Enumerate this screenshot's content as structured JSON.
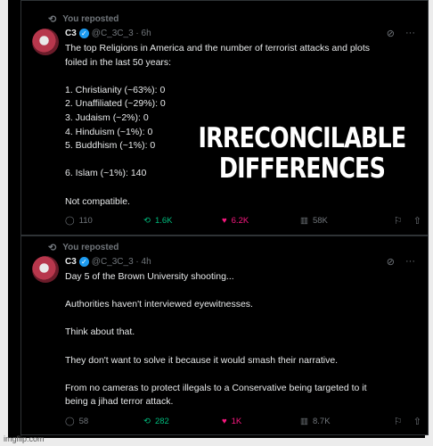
{
  "post1": {
    "repost_label": "You reposted",
    "author_name": "C3",
    "author_handle_time": "@C_3C_3 · 6h",
    "lines": [
      "The top Religions in America and the number of terrorist attacks and plots",
      "foiled in the last 50 years:",
      "",
      "1. Christianity (~63%): 0",
      "2. Unaffiliated (~29%): 0",
      "3. Judaism (~2%): 0",
      "4. Hinduism (~1%): 0",
      "5. Buddhism (~1%): 0",
      "",
      "6. Islam (~1%): 140",
      "",
      "Not compatible."
    ],
    "replies": "110",
    "reposts": "1.6K",
    "likes": "6.2K",
    "views": "58K"
  },
  "post2": {
    "repost_label": "You reposted",
    "author_name": "C3",
    "author_handle_time": "@C_3C_3 · 4h",
    "lines": [
      "Day 5 of the Brown University shooting...",
      "",
      "Authorities haven't interviewed eyewitnesses.",
      "",
      "Think about that.",
      "",
      "They don't want to solve it because it would smash their narrative.",
      "",
      "From no cameras to protect illegals to a Conservative being targeted to it",
      "being a jihad terror attack."
    ],
    "replies": "58",
    "reposts": "282",
    "likes": "1K",
    "views": "8.7K"
  },
  "overlay": {
    "line1": "IRRECONCILABLE",
    "line2": "DIFFERENCES"
  },
  "watermark": "imgflip.com",
  "icons": {
    "repost": "repost-icon",
    "reply": "reply-icon",
    "like": "heart-icon",
    "views": "views-icon",
    "bookmark": "bookmark-icon",
    "share": "share-icon",
    "grok": "grok-icon",
    "more": "more-icon"
  },
  "colors": {
    "background": "#000000",
    "text": "#e7e9ea",
    "muted": "#71767b",
    "repost_green": "#00ba7c",
    "like_pink": "#f91880",
    "verified_blue": "#1d9bf0"
  }
}
